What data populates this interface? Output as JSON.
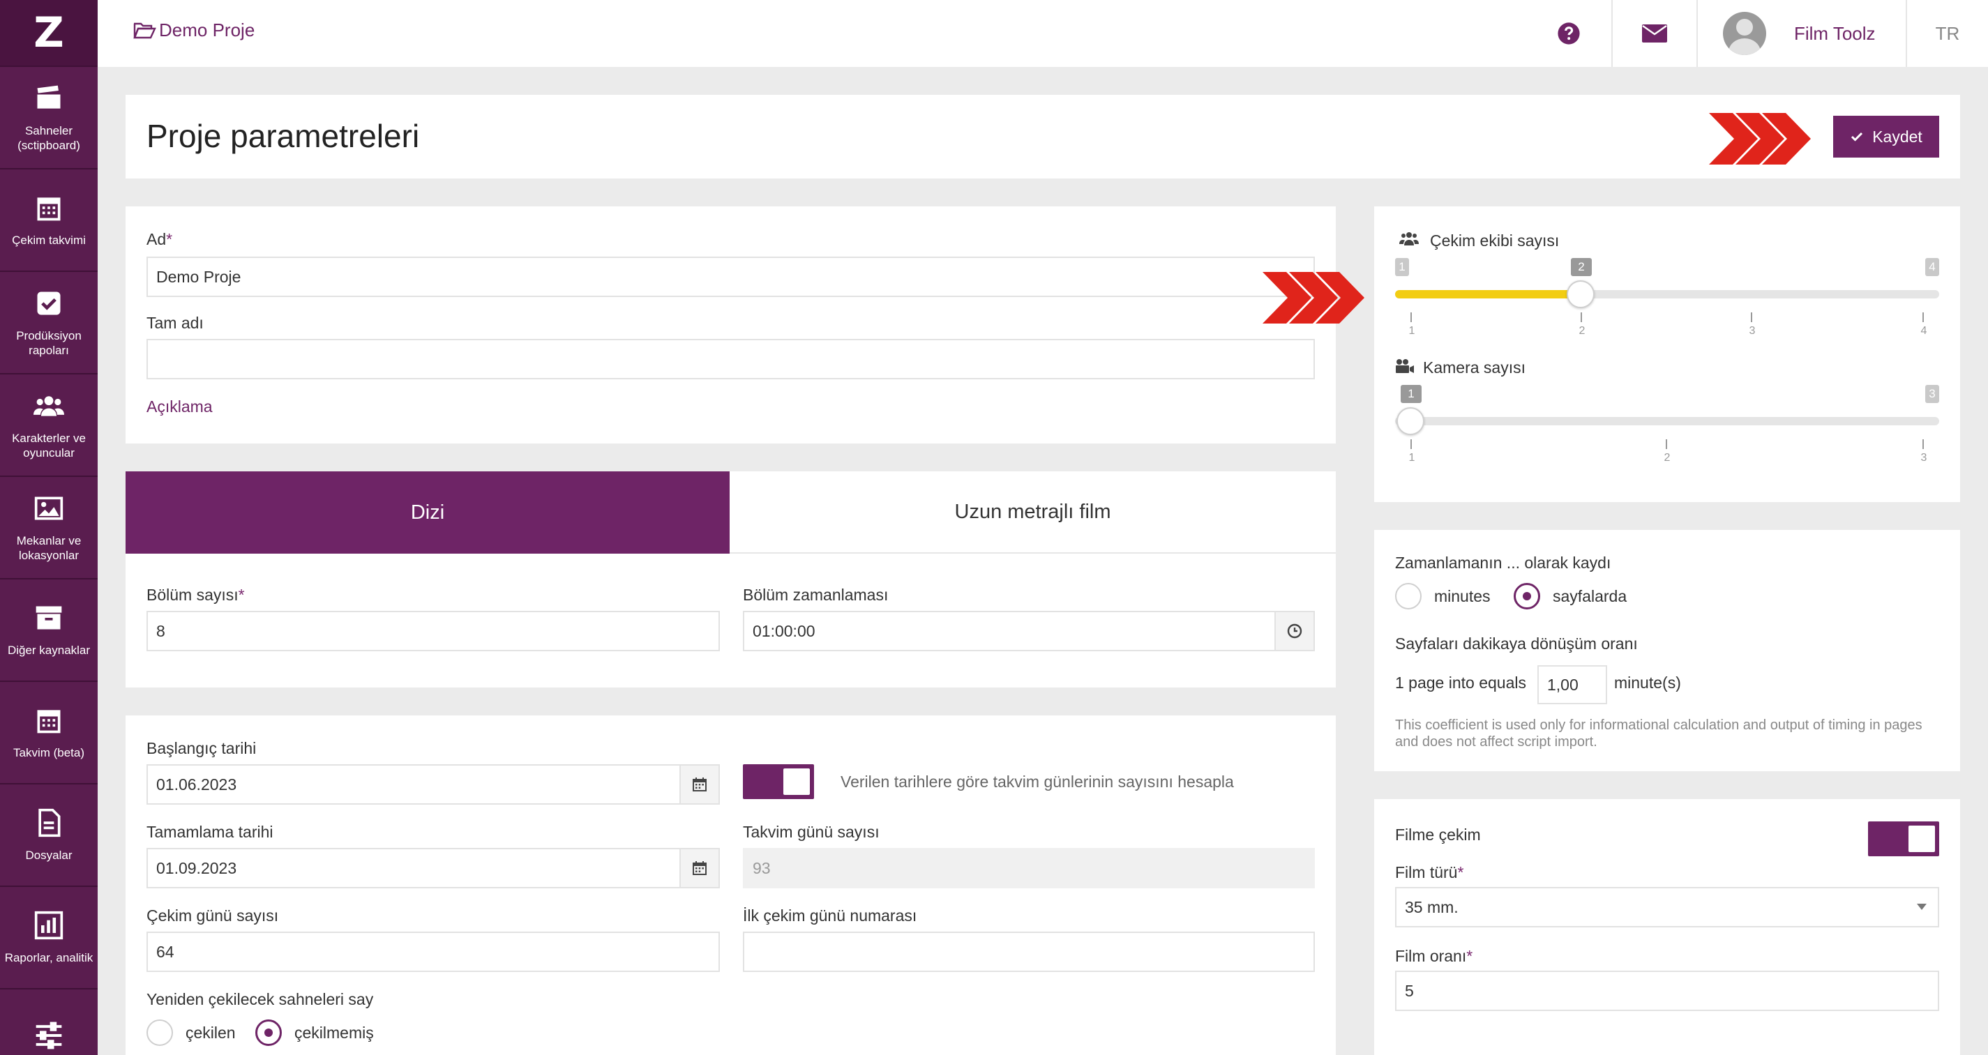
{
  "app": {
    "logo_letter": "Z",
    "accent_color": "#6e2466",
    "slider_fill_color": "#f2cd13"
  },
  "sidebar": {
    "items": [
      {
        "label": "Sahneler (sctipboard)",
        "icon": "clapperboard-icon"
      },
      {
        "label": "Çekim takvimi",
        "icon": "calendar-icon"
      },
      {
        "label": "Prodüksiyon rapoları",
        "icon": "checkbox-icon"
      },
      {
        "label": "Karakterler ve oyuncular",
        "icon": "users-icon"
      },
      {
        "label": "Mekanlar ve lokasyonlar",
        "icon": "image-icon"
      },
      {
        "label": "Diğer kaynaklar",
        "icon": "archive-icon"
      },
      {
        "label": "Takvim (beta)",
        "icon": "calendar-grid-icon"
      },
      {
        "label": "Dosyalar",
        "icon": "file-icon"
      },
      {
        "label": "Raporlar, analitik",
        "icon": "bar-chart-icon"
      },
      {
        "label": "",
        "icon": "sliders-icon"
      }
    ]
  },
  "topbar": {
    "breadcrumb": "Demo Proje",
    "user_name": "Film Toolz",
    "language": "TR"
  },
  "header": {
    "title": "Proje parametreleri",
    "save_label": "Kaydet"
  },
  "basic": {
    "name_label": "Ad",
    "name_value": "Demo Proje",
    "fullname_label": "Tam adı",
    "fullname_value": "",
    "description_link": "Açıklama"
  },
  "tabs": [
    {
      "label": "Dizi",
      "active": true
    },
    {
      "label": "Uzun metrajlı film",
      "active": false
    }
  ],
  "series": {
    "episodes_label": "Bölüm sayısı",
    "episodes_value": "8",
    "episode_timing_label": "Bölüm zamanlaması",
    "episode_timing_value": "01:00:00"
  },
  "dates": {
    "start_label": "Başlangıç tarihi",
    "start_value": "01.06.2023",
    "end_label": "Tamamlama tarihi",
    "end_value": "01.09.2023",
    "toggle_text": "Verilen tarihlere göre takvim günlerinin sayısını hesapla",
    "calendar_days_label": "Takvim günü sayısı",
    "calendar_days_value": "93",
    "shoot_days_label": "Çekim günü sayısı",
    "shoot_days_value": "64",
    "first_day_label": "İlk çekim günü numarası",
    "first_day_value": "",
    "recount_label": "Yeniden çekilecek sahneleri say",
    "recount_options": [
      {
        "label": "çekilen",
        "checked": false
      },
      {
        "label": "çekilmemiş",
        "checked": true
      }
    ]
  },
  "crew": {
    "crew_label": "Çekim ekibi sayısı",
    "crew_min": "1",
    "crew_max": "4",
    "crew_value": "2",
    "crew_ticks": [
      "1",
      "2",
      "3",
      "4"
    ],
    "camera_label": "Kamera sayısı",
    "camera_min": "1",
    "camera_max": "3",
    "camera_value": "1",
    "camera_ticks": [
      "1",
      "2",
      "3"
    ]
  },
  "timing": {
    "record_label": "Zamanlamanın ... olarak kaydı",
    "record_options": [
      {
        "label": "minutes",
        "checked": false
      },
      {
        "label": "sayfalarda",
        "checked": true
      }
    ],
    "ratio_label": "Sayfaları dakikaya dönüşüm oranı",
    "ratio_prefix": "1 page into equals",
    "ratio_value": "1,00",
    "ratio_suffix": "minute(s)",
    "note": "This coefficient is used only for informational calculation and output of timing in pages and does not affect script import."
  },
  "film": {
    "film_shoot_label": "Filme çekim",
    "film_type_label": "Film türü",
    "film_type_value": "35 mm.",
    "film_ratio_label": "Film oranı",
    "film_ratio_value": "5"
  }
}
